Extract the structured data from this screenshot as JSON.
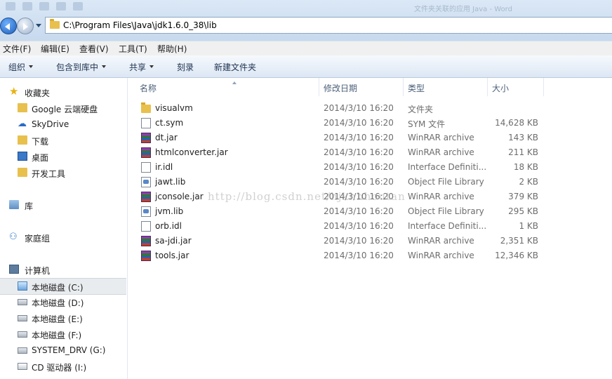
{
  "address": {
    "path": "C:\\Program Files\\Java\\jdk1.6.0_38\\lib"
  },
  "window": {
    "faint_title": "文件夹关联的应用 Java - Word"
  },
  "menu": [
    "文件(F)",
    "编辑(E)",
    "查看(V)",
    "工具(T)",
    "帮助(H)"
  ],
  "commands": {
    "organize": "组织",
    "include_library": "包含到库中",
    "share": "共享",
    "burn": "刻录",
    "new_folder": "新建文件夹"
  },
  "nav": {
    "favorites": "收藏夹",
    "fav_items": [
      "Google 云端硬盘",
      "SkyDrive",
      "下载",
      "桌面",
      "开发工具"
    ],
    "libraries": "库",
    "homegroup": "家庭组",
    "computer": "计算机",
    "drives": [
      "本地磁盘 (C:)",
      "本地磁盘 (D:)",
      "本地磁盘 (E:)",
      "本地磁盘 (F:)",
      "SYSTEM_DRV (G:)",
      "CD 驱动器 (I:)"
    ]
  },
  "columns": {
    "name": "名称",
    "date": "修改日期",
    "type": "类型",
    "size": "大小"
  },
  "files": [
    {
      "name": "visualvm",
      "date": "2014/3/10 16:20",
      "type": "文件夹",
      "size": "",
      "icon": "folder-icon"
    },
    {
      "name": "ct.sym",
      "date": "2014/3/10 16:20",
      "type": "SYM 文件",
      "size": "14,628 KB",
      "icon": "file-icon"
    },
    {
      "name": "dt.jar",
      "date": "2014/3/10 16:20",
      "type": "WinRAR archive",
      "size": "143 KB",
      "icon": "rar-icon"
    },
    {
      "name": "htmlconverter.jar",
      "date": "2014/3/10 16:20",
      "type": "WinRAR archive",
      "size": "211 KB",
      "icon": "rar-icon"
    },
    {
      "name": "ir.idl",
      "date": "2014/3/10 16:20",
      "type": "Interface Definiti...",
      "size": "18 KB",
      "icon": "file-icon"
    },
    {
      "name": "jawt.lib",
      "date": "2014/3/10 16:20",
      "type": "Object File Library",
      "size": "2 KB",
      "icon": "lib-icon"
    },
    {
      "name": "jconsole.jar",
      "date": "2014/3/10 16:20",
      "type": "WinRAR archive",
      "size": "379 KB",
      "icon": "rar-icon"
    },
    {
      "name": "jvm.lib",
      "date": "2014/3/10 16:20",
      "type": "Object File Library",
      "size": "295 KB",
      "icon": "lib-icon"
    },
    {
      "name": "orb.idl",
      "date": "2014/3/10 16:20",
      "type": "Interface Definiti...",
      "size": "1 KB",
      "icon": "file-icon"
    },
    {
      "name": "sa-jdi.jar",
      "date": "2014/3/10 16:20",
      "type": "WinRAR archive",
      "size": "2,351 KB",
      "icon": "rar-icon"
    },
    {
      "name": "tools.jar",
      "date": "2014/3/10 16:20",
      "type": "WinRAR archive",
      "size": "12,346 KB",
      "icon": "rar-icon"
    }
  ],
  "watermark": "http://blog.csdn.net/hjkhhhoutan"
}
